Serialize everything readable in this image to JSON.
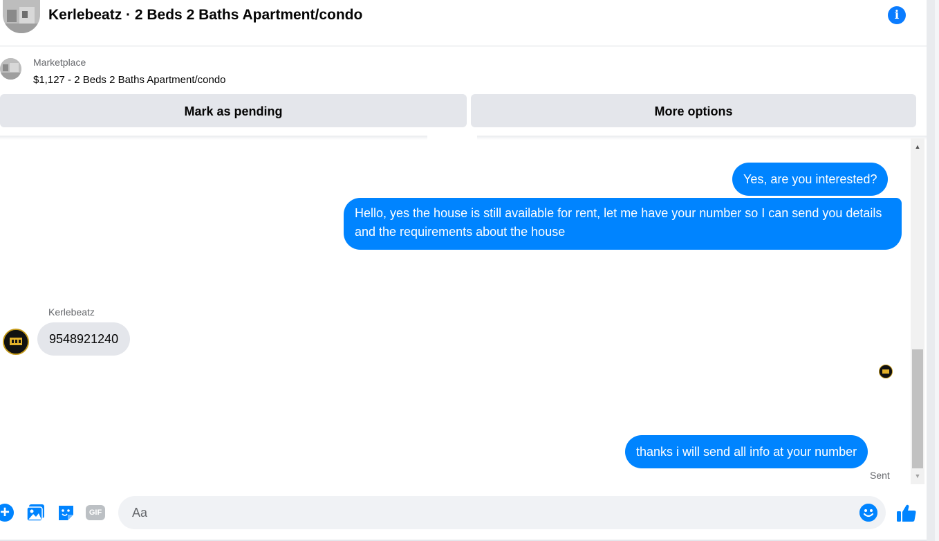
{
  "header": {
    "title": "Kerlebeatz · 2 Beds 2 Baths Apartment/condo",
    "info_icon": "info-icon"
  },
  "listing": {
    "label": "Marketplace",
    "summary": "$1,127 - 2 Beds 2 Baths Apartment/condo",
    "mark_pending_label": "Mark as pending",
    "more_options_label": "More options"
  },
  "messages": {
    "outgoing_1": "Yes, are you interested?",
    "outgoing_2": "Hello, yes the house is still available for rent, let me have your number so I can send you details and the requirements about the house",
    "incoming_sender": "Kerlebeatz",
    "incoming_1": "9548921240",
    "outgoing_3": "thanks i will send all info at your number",
    "status": "Sent"
  },
  "composer": {
    "placeholder": "Aa",
    "gif_label": "GIF",
    "icons": [
      "plus-icon",
      "photo-icon",
      "sticker-icon",
      "gif-icon",
      "emoji-icon",
      "thumbs-up-icon"
    ]
  },
  "colors": {
    "accent": "#0084ff",
    "incoming_bubble": "#e4e6eb",
    "button_bg": "#e4e6eb",
    "secondary_text": "#65676b"
  }
}
